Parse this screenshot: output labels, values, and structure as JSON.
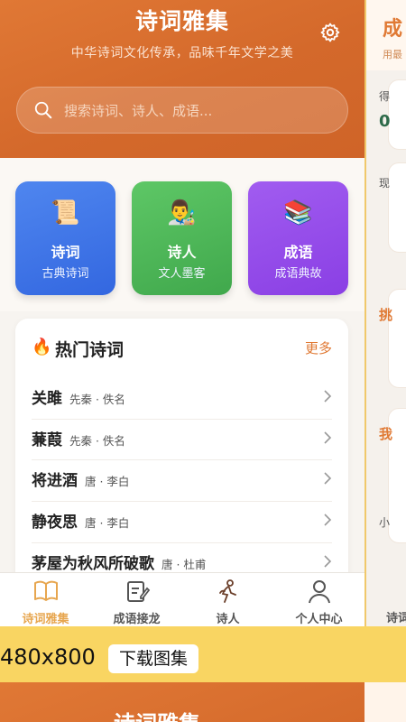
{
  "app": {
    "title": "诗词雅集",
    "subtitle": "中华诗词文化传承，品味千年文学之美"
  },
  "search": {
    "placeholder": "搜索诗词、诗人、成语..."
  },
  "categories": [
    {
      "emoji": "📜",
      "title": "诗词",
      "subtitle": "古典诗词",
      "color": "#3f72e6"
    },
    {
      "emoji": "👨‍🎨",
      "title": "诗人",
      "subtitle": "文人墨客",
      "color": "#4cb457"
    },
    {
      "emoji": "📚",
      "title": "成语",
      "subtitle": "成语典故",
      "color": "#9549ea"
    }
  ],
  "hot_poems": {
    "icon": "🔥",
    "title": "热门诗词",
    "more": "更多",
    "items": [
      {
        "title": "关雎",
        "meta": "先秦 · 佚名"
      },
      {
        "title": "蒹葭",
        "meta": "先秦 · 佚名"
      },
      {
        "title": "将进酒",
        "meta": "唐 · 李白"
      },
      {
        "title": "静夜思",
        "meta": "唐 · 李白"
      },
      {
        "title": "茅屋为秋风所破歌",
        "meta": "唐 · 杜甫"
      }
    ]
  },
  "tabbar": {
    "items": [
      {
        "label": "诗词雅集",
        "icon": "book-icon",
        "active": true
      },
      {
        "label": "成语接龙",
        "icon": "edit-doc-icon",
        "active": false
      },
      {
        "label": "诗人",
        "icon": "poet-icon",
        "active": false
      },
      {
        "label": "个人中心",
        "icon": "user-icon",
        "active": false
      }
    ]
  },
  "peek": {
    "title": "成",
    "subtitle": "用最",
    "card1_label": "得",
    "card1_value": "0",
    "card2_label": "现",
    "card3_label": "挑",
    "card4_label": "我",
    "card4_sub": "小",
    "tab_label": "诗词"
  },
  "strip": {
    "resolution": "480x800",
    "download": "下载图集"
  },
  "bottom_peek": {
    "title": "诗词雅集"
  },
  "colors": {
    "brand": "#d96e2f",
    "accent": "#e7a64f",
    "more_link": "#e07a35"
  }
}
